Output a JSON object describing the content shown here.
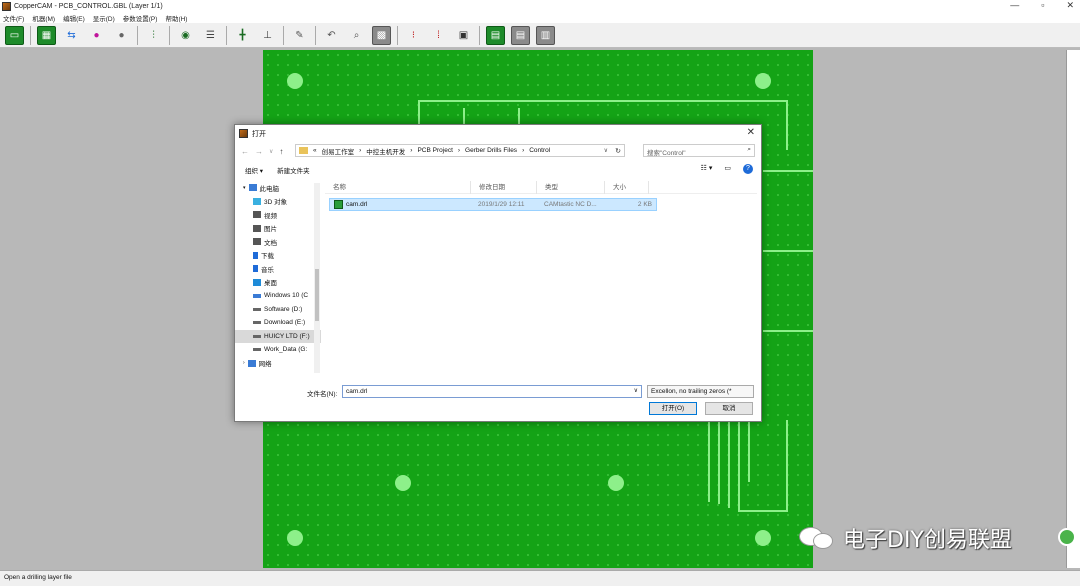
{
  "window": {
    "title": "CopperCAM  -  PCB_CONTROL.GBL  (Layer 1/1)",
    "controls": [
      "—",
      "▫",
      "✕"
    ]
  },
  "menu": [
    "文件(F)",
    "机器(M)",
    "编辑(E)",
    "显示(D)",
    "参数设置(P)",
    "帮助(H)"
  ],
  "status": {
    "text": "Open a drilling layer file"
  },
  "dialog": {
    "title": "打开",
    "breadcrumb": [
      "«",
      "创易工作室",
      "›",
      "中控主机开发",
      "›",
      "PCB Project",
      "›",
      "Gerber Drills Files",
      "›",
      "Control"
    ],
    "search_placeholder": "搜索\"Control\"",
    "organize": "组织 ▾",
    "new_folder": "新建文件夹",
    "nav": [
      {
        "label": "此电脑",
        "icon": "computer-icon",
        "color": "#3a7bd5"
      },
      {
        "label": "3D 对象",
        "icon": "cube-icon",
        "color": "#3ab0e0"
      },
      {
        "label": "视频",
        "icon": "video-icon",
        "color": "#555555"
      },
      {
        "label": "图片",
        "icon": "picture-icon",
        "color": "#555555"
      },
      {
        "label": "文档",
        "icon": "document-icon",
        "color": "#555555"
      },
      {
        "label": "下载",
        "icon": "download-icon",
        "color": "#1e6bd8"
      },
      {
        "label": "音乐",
        "icon": "music-icon",
        "color": "#1e6bd8"
      },
      {
        "label": "桌面",
        "icon": "desktop-icon",
        "color": "#1e8bd8"
      },
      {
        "label": "Windows 10 (C",
        "icon": "drive-icon",
        "color": "#3a7bd5"
      },
      {
        "label": "Software (D:)",
        "icon": "drive-icon",
        "color": "#666666"
      },
      {
        "label": "Download (E:)",
        "icon": "drive-icon",
        "color": "#666666"
      },
      {
        "label": "HUICY LTD (F:)",
        "icon": "drive-icon",
        "color": "#666666"
      },
      {
        "label": "Work_Data (G:",
        "icon": "drive-icon",
        "color": "#666666"
      },
      {
        "label": "网络",
        "icon": "network-icon",
        "color": "#3a7bd5"
      }
    ],
    "columns": [
      "名称",
      "修改日期",
      "类型",
      "大小"
    ],
    "files": [
      {
        "name": "cam.drl",
        "date": "2019/1/29 12:11",
        "type": "CAMtastic NC D...",
        "size": "2 KB"
      }
    ],
    "filename_label": "文件名(N):",
    "filename_value": "cam.drl",
    "filter_value": "Excellon, no trailing zeros  (*",
    "open_label": "打开(O)",
    "cancel_label": "取消"
  },
  "watermark": {
    "text": "电子DIY创易联盟"
  }
}
